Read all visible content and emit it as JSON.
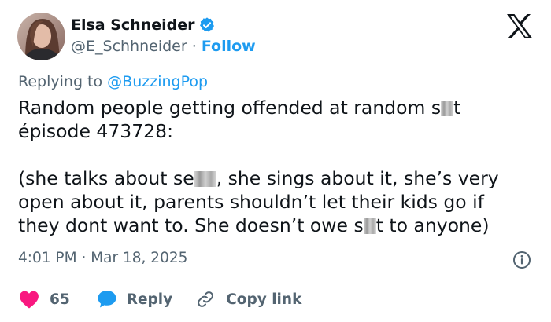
{
  "author": {
    "name": "Elsa Schneider",
    "handle": "@E_Schhneider",
    "separator": "·",
    "follow_label": "Follow"
  },
  "reply": {
    "prefix": "Replying to",
    "target": "@BuzzingPop"
  },
  "tweet": {
    "line1_before": "Random people getting offended at random s",
    "line1_after": "t",
    "line2": "épisode 473728:",
    "line3": "",
    "line4_before": "(she talks about se",
    "line4_after": ", she sings about it, she’s very",
    "line5": "open about it, parents shouldn’t let their kids go if",
    "line6_before": "they dont want to. She doesn’t owe s",
    "line6_after": "t to anyone)"
  },
  "timestamp": {
    "time": "4:01 PM",
    "separator": "·",
    "date": "Mar 18, 2025"
  },
  "actions": {
    "like_count": "65",
    "reply_label": "Reply",
    "copy_link_label": "Copy link"
  },
  "icons": {
    "verified": "verified-badge-icon",
    "logo": "x-logo-icon",
    "info": "info-icon",
    "heart": "heart-icon",
    "reply": "reply-bubble-icon",
    "link": "link-icon"
  },
  "colors": {
    "accent": "#1d9bf0",
    "like": "#f91880",
    "muted": "#536471",
    "text": "#0f1419"
  }
}
